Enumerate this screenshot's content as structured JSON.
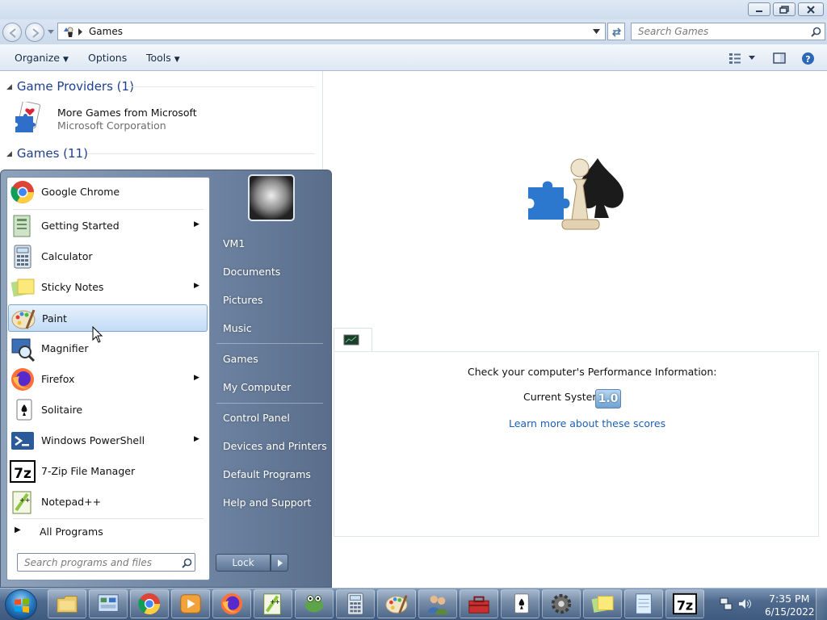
{
  "window": {
    "address": "Games",
    "search_placeholder": "Search Games"
  },
  "toolbar": {
    "organize": "Organize",
    "options": "Options",
    "tools": "Tools"
  },
  "groups": {
    "providers": "Game Providers (1)",
    "games": "Games (11)"
  },
  "provider": {
    "title": "More Games from Microsoft",
    "subtitle": "Microsoft Corporation"
  },
  "performance": {
    "title": "Check your computer's Performance Information:",
    "label": "Current System",
    "score": "1.0",
    "link": "Learn more about these scores"
  },
  "start_menu": {
    "programs": [
      {
        "label": "Google Chrome",
        "icon": "chrome-icon",
        "submenu": false
      },
      {
        "label": "Getting Started",
        "icon": "getting-started-icon",
        "submenu": true
      },
      {
        "label": "Calculator",
        "icon": "calculator-icon",
        "submenu": false
      },
      {
        "label": "Sticky Notes",
        "icon": "sticky-notes-icon",
        "submenu": true
      },
      {
        "label": "Paint",
        "icon": "paint-icon",
        "submenu": false,
        "highlighted": true
      },
      {
        "label": "Magnifier",
        "icon": "magnifier-icon",
        "submenu": false
      },
      {
        "label": "Firefox",
        "icon": "firefox-icon",
        "submenu": true
      },
      {
        "label": "Solitaire",
        "icon": "solitaire-icon",
        "submenu": false
      },
      {
        "label": "Windows PowerShell",
        "icon": "powershell-icon",
        "submenu": true
      },
      {
        "label": "7-Zip File Manager",
        "icon": "7zip-icon",
        "submenu": false
      },
      {
        "label": "Notepad++",
        "icon": "notepadpp-icon",
        "submenu": false
      }
    ],
    "all_programs": "All Programs",
    "search_placeholder": "Search programs and files",
    "right_links": [
      "VM1",
      "Documents",
      "Pictures",
      "Music",
      "Games",
      "My Computer",
      "Control Panel",
      "Devices and Printers",
      "Default Programs",
      "Help and Support"
    ],
    "lock": "Lock"
  },
  "taskbar": {
    "time": "7:35 PM",
    "date": "6/15/2022",
    "pinned": [
      "explorer-icon",
      "control-panel-icon",
      "chrome-icon",
      "media-player-icon",
      "firefox-icon",
      "notepadpp-icon",
      "frog-app-icon",
      "calculator-icon",
      "paint-icon",
      "users-icon",
      "toolbox-icon",
      "solitaire-icon",
      "gear-icon",
      "sticky-notes-icon",
      "notepad-icon",
      "7zip-icon"
    ]
  }
}
